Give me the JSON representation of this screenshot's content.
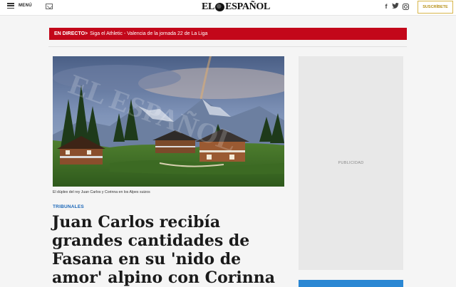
{
  "header": {
    "menu_label": "MENÚ",
    "logo_left": "EL",
    "logo_right": "ESPAÑOL",
    "subscribe_label": "SUSCRÍBETE",
    "social": {
      "facebook": "f",
      "twitter": "🐦",
      "instagram": ""
    },
    "colors": {
      "subscribe_border": "#d8b64a"
    }
  },
  "live": {
    "label": "EN DIRECTO>",
    "text": "Siga el Athletic - Valencia de la jornada 22 de La Liga",
    "color": "#c3071a"
  },
  "article": {
    "image_icon": "chalets-alps-photo",
    "caption": "El dúplex del rey Juan Carlos y Corinna en los Alpes suizos",
    "section": "TRIBUNALES",
    "headline": "Juan Carlos recibía grandes cantidades de Fasana en su 'nido de amor' alpino con Corinna"
  },
  "sidebar": {
    "ad_label": "PUBLICIDAD"
  }
}
